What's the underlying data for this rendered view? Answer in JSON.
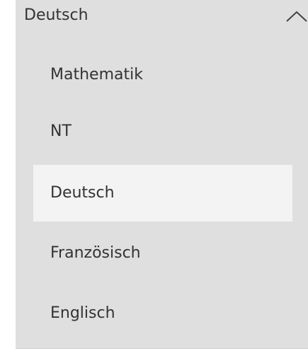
{
  "dropdown": {
    "selected_value": "Deutsch",
    "expanded": true,
    "chevron_icon": "chevron-up-icon",
    "options": [
      {
        "label": "Mathematik",
        "selected": false
      },
      {
        "label": "NT",
        "selected": false
      },
      {
        "label": "Deutsch",
        "selected": true
      },
      {
        "label": "Französisch",
        "selected": false
      },
      {
        "label": "Englisch",
        "selected": false
      }
    ]
  },
  "colors": {
    "panel_background": "#dfdfdf",
    "selected_option_background": "#f3f3f3",
    "text": "#333333"
  }
}
